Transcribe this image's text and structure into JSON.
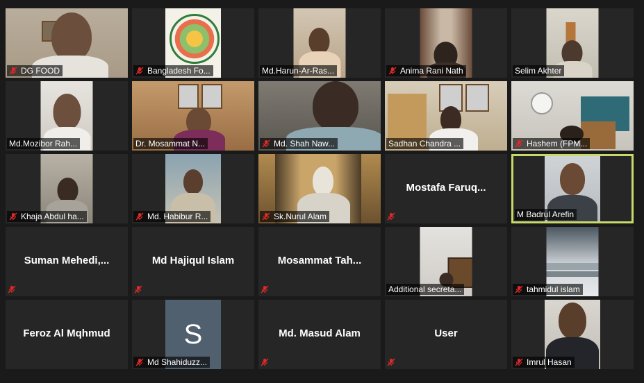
{
  "participants": [
    {
      "name": "DG FOOD",
      "muted": true,
      "type": "video"
    },
    {
      "name": "Bangladesh Fo...",
      "muted": true,
      "type": "video"
    },
    {
      "name": "Md.Harun-Ar-Ras...",
      "muted": false,
      "type": "video"
    },
    {
      "name": "Anima Rani Nath",
      "muted": true,
      "type": "video"
    },
    {
      "name": "Selim Akhter",
      "muted": false,
      "type": "video"
    },
    {
      "name": "Md.Mozibor Rah...",
      "muted": false,
      "type": "video"
    },
    {
      "name": "Dr. Mosammat N...",
      "muted": false,
      "type": "video"
    },
    {
      "name": "Md. Shah Naw...",
      "muted": true,
      "type": "video"
    },
    {
      "name": "Sadhan Chandra ...",
      "muted": false,
      "type": "video"
    },
    {
      "name": "Hashem (FPM...",
      "muted": true,
      "type": "video"
    },
    {
      "name": "Khaja Abdul ha...",
      "muted": true,
      "type": "video"
    },
    {
      "name": "Md. Habibur R...",
      "muted": true,
      "type": "video"
    },
    {
      "name": "Sk.Nurul Alam",
      "muted": true,
      "type": "video"
    },
    {
      "name": "Mostafa Faruq...",
      "muted": true,
      "type": "name-only"
    },
    {
      "name": "M Badrul Arefin",
      "muted": false,
      "type": "video",
      "active_speaker": true
    },
    {
      "name": "Suman Mehedi,...",
      "muted": true,
      "type": "name-only"
    },
    {
      "name": "Md Hajiqul Islam",
      "muted": true,
      "type": "name-only"
    },
    {
      "name": "Mosammat Tah...",
      "muted": true,
      "type": "name-only"
    },
    {
      "name": "Additional secreta...",
      "muted": false,
      "type": "video"
    },
    {
      "name": "tahmidul islam",
      "muted": true,
      "type": "video"
    },
    {
      "name": "Feroz Al Mqhmud",
      "muted": false,
      "type": "name-only"
    },
    {
      "name": "Md Shahiduzz...",
      "muted": true,
      "type": "avatar",
      "initial": "S"
    },
    {
      "name": "Md. Masud Alam",
      "muted": true,
      "type": "name-only"
    },
    {
      "name": "User",
      "muted": true,
      "type": "name-only"
    },
    {
      "name": "Imrul Hasan",
      "muted": true,
      "type": "video"
    }
  ],
  "colors": {
    "background": "#1a1a1a",
    "tile": "#262626",
    "active_border": "#c8d96a",
    "muted_icon": "#e02828",
    "avatar_bg": "#50606e"
  },
  "icons": {
    "muted": "mic-muted-icon"
  }
}
